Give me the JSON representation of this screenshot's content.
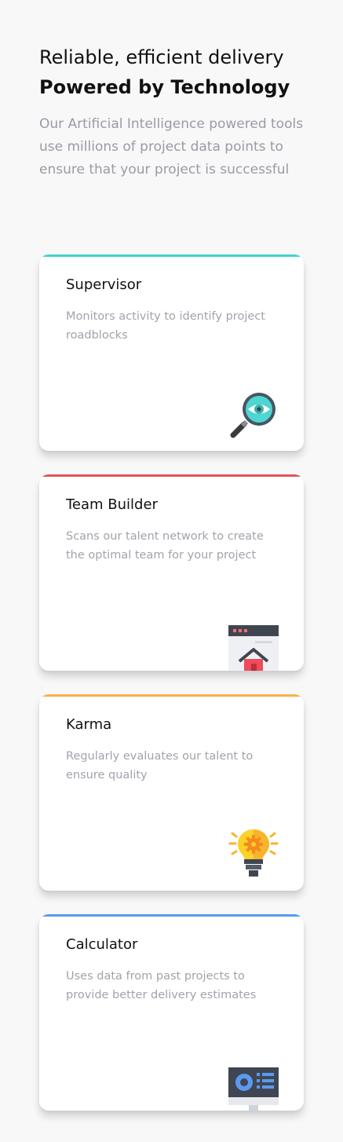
{
  "hero": {
    "title_line1": "Reliable, efficient delivery",
    "title_line2": "Powered by Technology",
    "description": "Our Artificial Intelligence powered tools use millions of project data points to ensure that your project is successful"
  },
  "cards": [
    {
      "title": "Supervisor",
      "description": "Monitors activity to identify project roadblocks",
      "accent_color": "#3ed4d0",
      "icon": "magnifier-eye-icon"
    },
    {
      "title": "Team Builder",
      "description": "Scans our talent network to create the optimal team for your project",
      "accent_color": "#e2545a",
      "icon": "browser-home-icon"
    },
    {
      "title": "Karma",
      "description": "Regularly evaluates our talent to ensure quality",
      "accent_color": "#fbb04b",
      "icon": "lightbulb-gear-icon"
    },
    {
      "title": "Calculator",
      "description": "Uses data from past projects to provide better delivery estimates",
      "accent_color": "#5a9af0",
      "icon": "monitor-dashboard-icon"
    }
  ]
}
